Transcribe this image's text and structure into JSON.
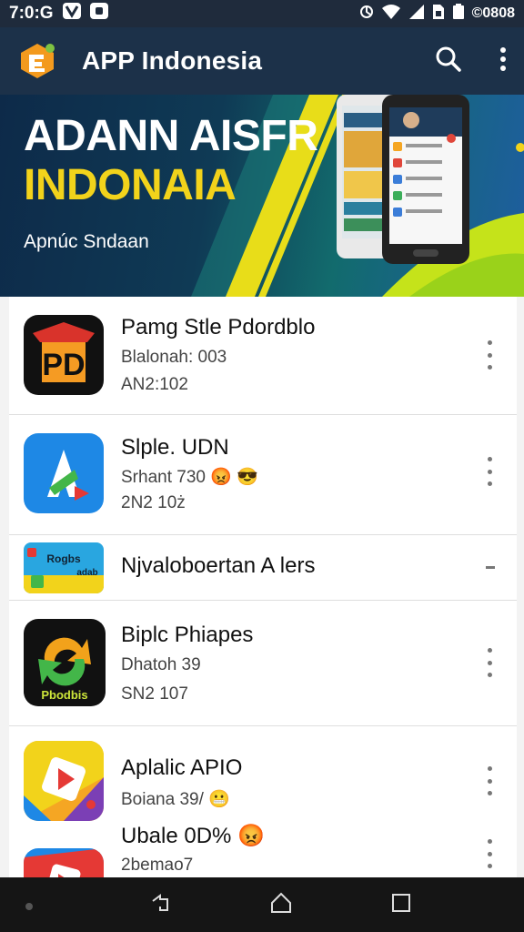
{
  "status_bar": {
    "time": "7:0:G",
    "right_text": "©0808",
    "icons": [
      "notification-v-icon",
      "notification-box-icon",
      "sync-icon",
      "wifi-icon",
      "signal-icon",
      "sim-icon",
      "battery-icon"
    ]
  },
  "app_bar": {
    "title": "APP Indonesia",
    "actions": [
      "search-icon",
      "more-vert-icon"
    ]
  },
  "banner": {
    "line1": "ADANN AISFR",
    "line2": "INDONAIA",
    "subtitle": "Apnúc Sndaan",
    "colors": {
      "line2": "#f2d31b",
      "accent_lime": "#c5e31a"
    }
  },
  "apps": [
    {
      "title": "Pamg Stle Pdordblo",
      "line2": "Blalonah: 003",
      "line3": "AN2:102",
      "icon": "pd-app-icon"
    },
    {
      "title": "Slple. UDN",
      "line2": "Srhant 730",
      "line3": "2N2 10ż",
      "icon": "a-arrow-app-icon",
      "emoji": [
        "😡",
        "😎"
      ]
    },
    {
      "title": "Njvaloboertan A lers",
      "line2": "",
      "line3": "",
      "icon": "banner-app-icon",
      "banner_text": [
        "Rogbs",
        "adab"
      ]
    },
    {
      "title": "Biplc Phiapes",
      "line2": "Dhatoh 39",
      "line3": "SN2 107",
      "icon": "sync-app-icon",
      "icon_text": "Pbodbis"
    },
    {
      "title": "Aplalic APIO",
      "line2": "Boiana 39/",
      "line3": "",
      "icon": "play-app-icon",
      "emoji": [
        "😬"
      ]
    },
    {
      "title": "Ubale 0D%",
      "line2": "2bemao7",
      "line3": "",
      "icon": "red-app-icon",
      "emoji": [
        "😡"
      ]
    }
  ],
  "nav_bar": {
    "buttons": [
      "back-icon",
      "home-icon",
      "recents-icon"
    ]
  }
}
